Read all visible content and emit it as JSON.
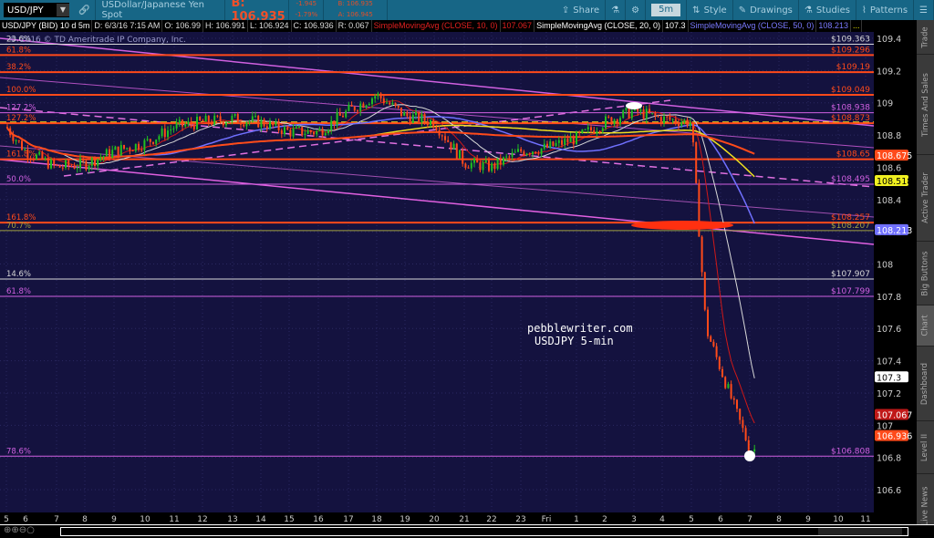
{
  "toolbar": {
    "symbol": "USD/JPY",
    "description": "USDollar/Japanese Yen Spot",
    "bid": "B: 106.935",
    "change": "-1.945",
    "change_pct": "-1.79%",
    "bid_small": "B: 106.935",
    "ask_small": "A: 106.945",
    "share": "Share",
    "timeframe": "5m",
    "style": "Style",
    "drawings": "Drawings",
    "studies": "Studies",
    "patterns": "Patterns"
  },
  "info": {
    "title": "USD/JPY (BID) 10 d 5m",
    "date": "D: 6/3/16 7:15 AM",
    "open": "O: 106.99",
    "high": "H: 106.991",
    "low": "L: 106.924",
    "close": "C: 106.936",
    "range": "R: 0.067",
    "sma10": "SimpleMovingAvg (CLOSE, 10, 0)",
    "sma10_val": "107.067",
    "sma20": "SimpleMovingAvg (CLOSE, 20, 0)",
    "sma20_val": "107.3",
    "sma50": "SimpleMovingAvg (CLOSE, 50, 0)",
    "sma50_val": "108.213",
    "more": "..."
  },
  "copyright": "© 2016 © TD Ameritrade IP Company, Inc.",
  "watermark": [
    "pebblewriter.com",
    "USDJPY 5-min"
  ],
  "colors": {
    "bg": "#14123f",
    "red": "#ff4a1a",
    "purple": "#d060e0",
    "white": "#d8d8d8",
    "yellow": "#f0e020",
    "blue": "#7070ff",
    "olive": "#a0a040"
  },
  "price_axis": {
    "ticks": [
      109.4,
      109.2,
      109,
      108.8,
      108.6,
      108.4,
      108.2,
      108,
      107.8,
      107.6,
      107.4,
      107.2,
      107,
      106.8,
      106.6
    ],
    "markers": [
      {
        "label": "108.675",
        "price": 108.675,
        "color": "#ff4a1a"
      },
      {
        "label": "108.518",
        "price": 108.518,
        "color": "#f0f020"
      },
      {
        "label": "108.213",
        "price": 108.213,
        "color": "#7070ff"
      },
      {
        "label": "107.3",
        "price": 107.3,
        "color": "#ffffff"
      },
      {
        "label": "107.067",
        "price": 107.067,
        "color": "#c01818"
      },
      {
        "label": "106.936",
        "price": 106.936,
        "color": "#ff4a1a"
      }
    ]
  },
  "levels": [
    {
      "pct": "23.6%",
      "label": "$109.363",
      "price": 109.363,
      "color": "#d8d8d8"
    },
    {
      "pct": "61.8%",
      "label": "$109.296",
      "price": 109.296,
      "color": "#ff4a1a"
    },
    {
      "pct": "38.2%",
      "label": "$109.19",
      "price": 109.19,
      "color": "#ff4a1a"
    },
    {
      "pct": "100.0%",
      "label": "$109.049",
      "price": 109.049,
      "color": "#ff4a1a"
    },
    {
      "pct": "127.2%",
      "label": "$108.938",
      "price": 108.938,
      "color": "#d060e0"
    },
    {
      "pct": "127.2%",
      "label": "$108.873",
      "price": 108.873,
      "color": "#ff4a1a"
    },
    {
      "pct": "161.8%",
      "label": "$108.65",
      "price": 108.65,
      "color": "#ff4a1a"
    },
    {
      "pct": "50.0%",
      "label": "$108.495",
      "price": 108.495,
      "color": "#d060e0"
    },
    {
      "pct": "161.8%",
      "label": "$108.257",
      "price": 108.257,
      "color": "#ff4a1a"
    },
    {
      "pct": "70.7%",
      "label": "$108.207",
      "price": 108.207,
      "color": "#a0a040"
    },
    {
      "pct": "14.6%",
      "label": "$107.907",
      "price": 107.907,
      "color": "#d8d8d8"
    },
    {
      "pct": "61.8%",
      "label": "$107.799",
      "price": 107.799,
      "color": "#d060e0"
    },
    {
      "pct": "78.6%",
      "label": "$106.808",
      "price": 106.808,
      "color": "#d060e0"
    }
  ],
  "time_axis": [
    "5",
    "6",
    "7",
    "8",
    "9",
    "10",
    "11",
    "12",
    "13",
    "14",
    "15",
    "16",
    "17",
    "18",
    "19",
    "20",
    "21",
    "22",
    "23",
    "Fri",
    "1",
    "2",
    "3",
    "4",
    "5",
    "6",
    "7",
    "8",
    "9",
    "10",
    "11"
  ],
  "price_path": [
    108.85,
    108.7,
    108.6,
    108.62,
    108.7,
    108.75,
    108.85,
    108.88,
    108.9,
    108.88,
    108.82,
    108.82,
    108.95,
    109.05,
    108.92,
    108.88,
    108.63,
    108.6,
    108.7,
    108.72,
    108.78,
    108.88,
    108.95,
    108.9,
    108.88,
    107.6,
    106.85
  ],
  "side_tabs": [
    "Trade",
    "Times And Sales",
    "Active Trader",
    "Big Buttons",
    "Chart",
    "Dashboard",
    "Level II",
    "Live News"
  ]
}
